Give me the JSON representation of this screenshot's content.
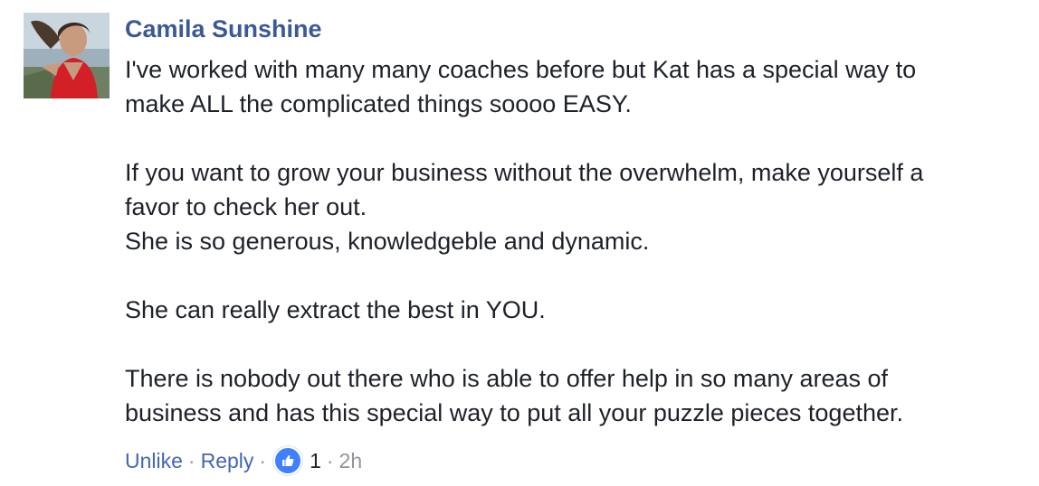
{
  "comment": {
    "author": "Camila Sunshine",
    "paragraphs": [
      [
        "I've worked with many many coaches before but Kat has a special way to",
        "make ALL the complicated things soooo EASY."
      ],
      [
        "If you want to grow your business without the overwhelm, make yourself a",
        "favor to check her out.",
        "She is so generous, knowledgeble and dynamic."
      ],
      [
        "She can really extract the best in YOU."
      ],
      [
        "There is nobody out there who is able to offer help in so many areas of",
        "business and has this special way to put all your puzzle pieces together."
      ]
    ],
    "actions": {
      "unlike_label": "Unlike",
      "reply_label": "Reply",
      "separator": "·",
      "like_count": "1",
      "timestamp": "2h"
    },
    "colors": {
      "author": "#3b5998",
      "link": "#4267b2",
      "text": "#1d2129",
      "meta": "#90949c",
      "like_badge": "#4080ff"
    },
    "icons": {
      "avatar": "profile-photo",
      "reaction": "thumbs-up-icon"
    }
  }
}
